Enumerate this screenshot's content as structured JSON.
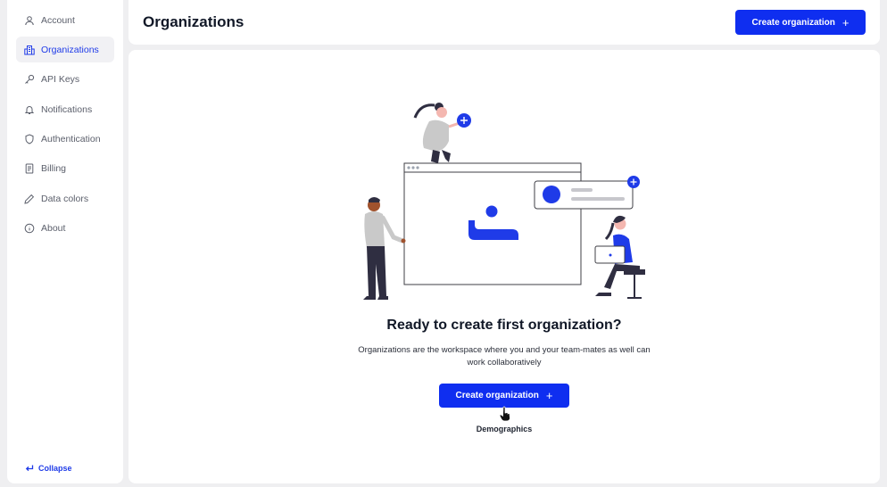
{
  "sidebar": {
    "items": [
      {
        "label": "Account",
        "icon": "user-icon",
        "active": false
      },
      {
        "label": "Organizations",
        "icon": "building-icon",
        "active": true
      },
      {
        "label": "API Keys",
        "icon": "key-icon",
        "active": false
      },
      {
        "label": "Notifications",
        "icon": "bell-icon",
        "active": false
      },
      {
        "label": "Authentication",
        "icon": "shield-icon",
        "active": false
      },
      {
        "label": "Billing",
        "icon": "document-icon",
        "active": false
      },
      {
        "label": "Data colors",
        "icon": "pen-icon",
        "active": false
      },
      {
        "label": "About",
        "icon": "info-icon",
        "active": false
      }
    ],
    "collapse_label": "Collapse"
  },
  "header": {
    "title": "Organizations",
    "create_button_label": "Create organization"
  },
  "empty_state": {
    "title": "Ready to create first organization?",
    "description": "Organizations are the workspace where you and your team-mates as well can work collaboratively",
    "create_button_label": "Create organization",
    "tooltip": "Demographics"
  },
  "colors": {
    "accent": "#0f2ef0",
    "background": "#efeff1",
    "active_nav_bg": "#f1f1f4"
  }
}
